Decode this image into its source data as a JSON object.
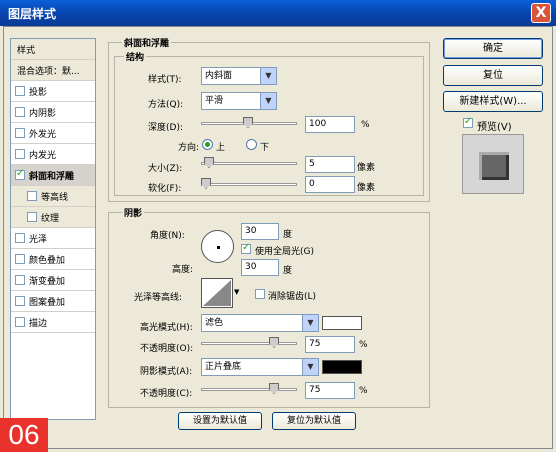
{
  "window": {
    "title": "图层样式",
    "close_label": "X"
  },
  "badge": "06",
  "sidebar": {
    "header": "样式",
    "blend_label": "混合选项：默...",
    "items": [
      {
        "label": "投影",
        "checked": false
      },
      {
        "label": "内阴影",
        "checked": false
      },
      {
        "label": "外发光",
        "checked": false
      },
      {
        "label": "内发光",
        "checked": false
      },
      {
        "label": "斜面和浮雕",
        "checked": true
      },
      {
        "label": "等高线",
        "checked": false
      },
      {
        "label": "纹理",
        "checked": false
      },
      {
        "label": "光泽",
        "checked": false
      },
      {
        "label": "颜色叠加",
        "checked": false
      },
      {
        "label": "渐变叠加",
        "checked": false
      },
      {
        "label": "图案叠加",
        "checked": false
      },
      {
        "label": "描边",
        "checked": false
      }
    ]
  },
  "bevel": {
    "group_title": "斜面和浮雕",
    "struct_title": "结构",
    "style_label": "样式(T):",
    "style_value": "内斜面",
    "technique_label": "方法(Q):",
    "technique_value": "平滑",
    "depth_label": "深度(D):",
    "depth_value": "100",
    "depth_unit": "%",
    "direction_label": "方向:",
    "direction_up": "上",
    "direction_down": "下",
    "size_label": "大小(Z):",
    "size_value": "5",
    "size_unit": "像素",
    "soften_label": "软化(F):",
    "soften_value": "0",
    "soften_unit": "像素"
  },
  "shading": {
    "group_title": "阴影",
    "angle_label": "角度(N):",
    "angle_value": "30",
    "angle_unit": "度",
    "global_light_label": "使用全局光(G)",
    "altitude_label": "高度:",
    "altitude_value": "30",
    "altitude_unit": "度",
    "gloss_label": "光泽等高线:",
    "antialias_label": "消除锯齿(L)",
    "highlight_label": "高光模式(H):",
    "highlight_value": "滤色",
    "highlight_opacity_label": "不透明度(O):",
    "highlight_opacity_value": "75",
    "shadow_label": "阴影模式(A):",
    "shadow_value": "正片叠底",
    "shadow_opacity_label": "不透明度(C):",
    "shadow_opacity_value": "75",
    "percent": "%",
    "highlight_color": "#ffffff",
    "shadow_color": "#000000"
  },
  "buttons": {
    "ok": "确定",
    "reset": "复位",
    "new_style": "新建样式(W)...",
    "preview_label": "预览(V)",
    "make_default": "设置为默认值",
    "reset_default": "复位为默认值"
  }
}
